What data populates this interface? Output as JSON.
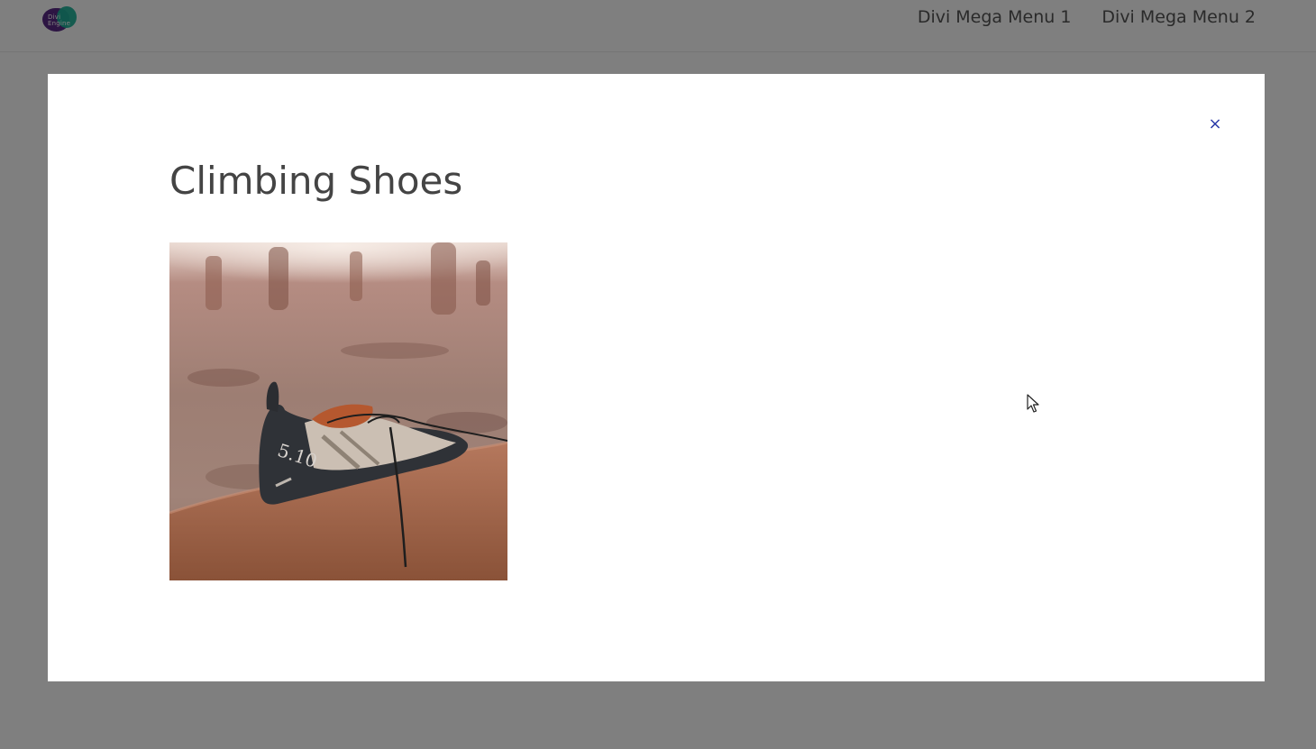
{
  "header": {
    "logo_text": "Divi Engine",
    "nav": [
      {
        "label": "Divi Mega Menu 1"
      },
      {
        "label": "Divi Mega Menu 2"
      }
    ]
  },
  "modal": {
    "title": "Climbing Shoes",
    "close_symbol": "×",
    "image": {
      "icon": "climbing-shoe-photo",
      "shoe_brand_text": "5.10"
    }
  },
  "colors": {
    "overlay": "#808080",
    "close_icon": "#2a3aa8",
    "title": "#444444",
    "nav_text": "#333333"
  }
}
